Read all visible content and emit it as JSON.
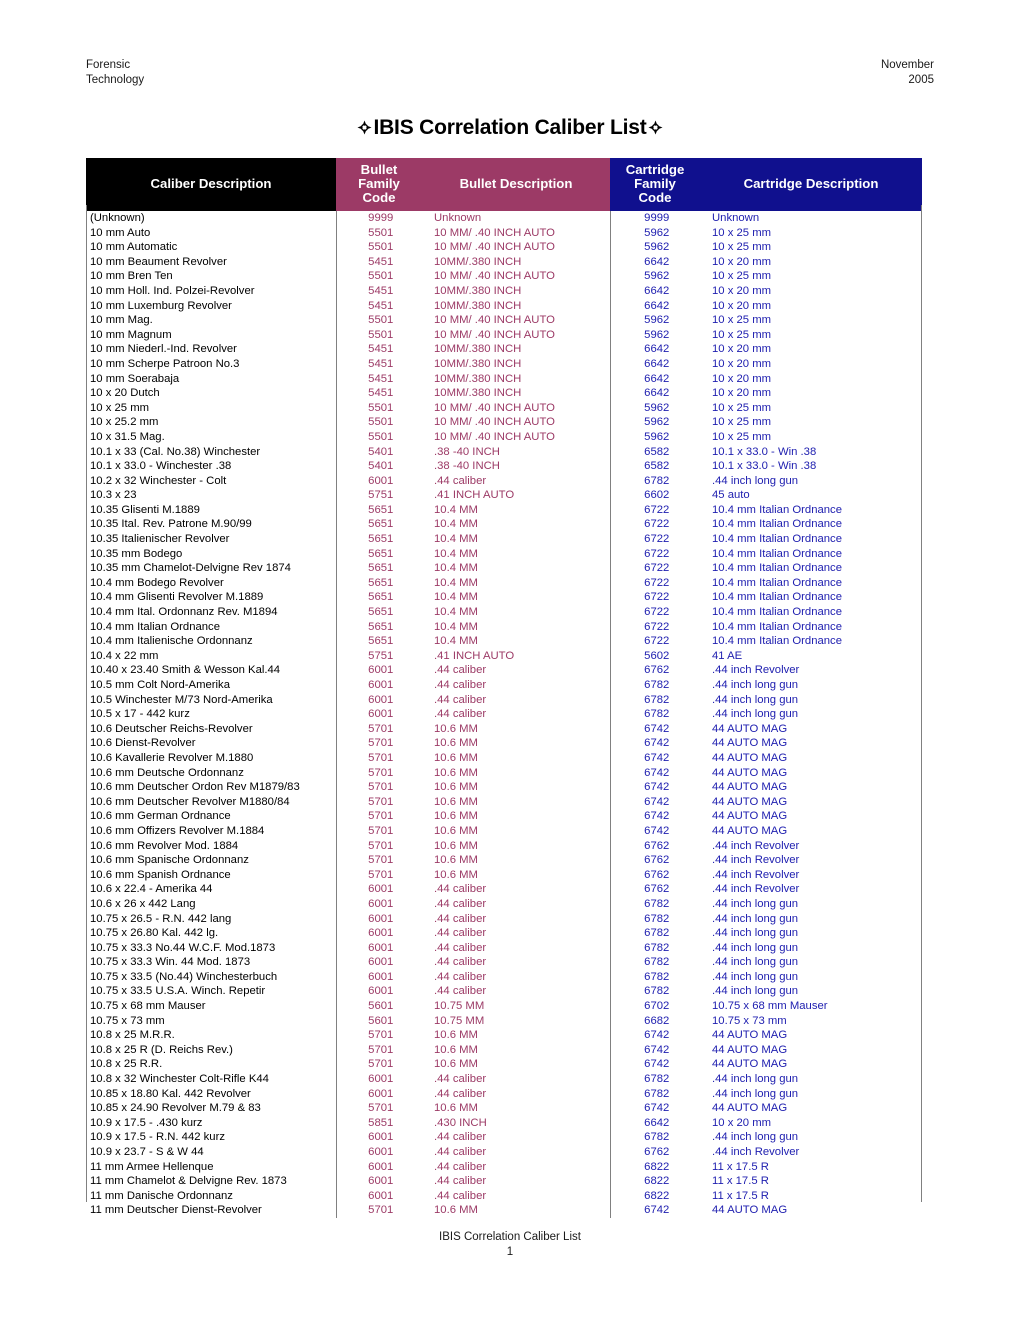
{
  "running_head": {
    "left_line1": "Forensic",
    "left_line2": "Technology",
    "right_line1": "November",
    "right_line2": "2005"
  },
  "title": {
    "text": "IBIS Correlation Caliber List",
    "left_icon": "crosshair-icon",
    "right_icon": "crosshair-icon"
  },
  "colors": {
    "caliber_header_bg": "#000000",
    "bullet_header_bg": "#9C3A66",
    "cartridge_header_bg": "#10108E",
    "bullet_text": "#9C3A66",
    "cartridge_text": "#2020B0",
    "rule": "#808080"
  },
  "table": {
    "columns": [
      "Caliber Description",
      "Bullet Family Code",
      "Bullet Description",
      "Cartridge Family Code",
      "Cartridge Description"
    ],
    "headers": {
      "caliber_description": "Caliber Description",
      "bullet_family_code_l1": "Bullet Family",
      "bullet_family_code_l2": "Code",
      "bullet_description": "Bullet Description",
      "cartridge_family_code_l1": "Cartridge Family",
      "cartridge_family_code_l2": "Code",
      "cartridge_description": "Cartridge Description"
    },
    "rows": [
      [
        "(Unknown)",
        "9999",
        "Unknown",
        "9999",
        "Unknown"
      ],
      [
        "10 mm Auto",
        "5501",
        "10 MM/ .40 INCH AUTO",
        "5962",
        "10 x 25 mm"
      ],
      [
        "10 mm Automatic",
        "5501",
        "10 MM/ .40 INCH AUTO",
        "5962",
        "10 x 25 mm"
      ],
      [
        "10 mm Beaument Revolver",
        "5451",
        "10MM/.380 INCH",
        "6642",
        "10 x 20 mm"
      ],
      [
        "10 mm Bren Ten",
        "5501",
        "10 MM/ .40 INCH AUTO",
        "5962",
        "10 x 25 mm"
      ],
      [
        "10 mm Holl. Ind. Polzei-Revolver",
        "5451",
        "10MM/.380 INCH",
        "6642",
        "10 x 20 mm"
      ],
      [
        "10 mm Luxemburg Revolver",
        "5451",
        "10MM/.380 INCH",
        "6642",
        "10 x 20 mm"
      ],
      [
        "10 mm Mag.",
        "5501",
        "10 MM/ .40 INCH AUTO",
        "5962",
        "10 x 25 mm"
      ],
      [
        "10 mm Magnum",
        "5501",
        "10 MM/ .40 INCH AUTO",
        "5962",
        "10 x 25 mm"
      ],
      [
        "10 mm Niederl.-Ind. Revolver",
        "5451",
        "10MM/.380 INCH",
        "6642",
        "10 x 20 mm"
      ],
      [
        "10 mm Scherpe Patroon No.3",
        "5451",
        "10MM/.380 INCH",
        "6642",
        "10 x 20 mm"
      ],
      [
        "10 mm Soerabaja",
        "5451",
        "10MM/.380 INCH",
        "6642",
        "10 x 20 mm"
      ],
      [
        "10 x 20 Dutch",
        "5451",
        "10MM/.380 INCH",
        "6642",
        "10 x 20 mm"
      ],
      [
        "10 x 25 mm",
        "5501",
        "10 MM/ .40 INCH AUTO",
        "5962",
        "10 x 25 mm"
      ],
      [
        "10 x 25.2 mm",
        "5501",
        "10 MM/ .40 INCH AUTO",
        "5962",
        "10 x 25 mm"
      ],
      [
        "10 x 31.5 Mag.",
        "5501",
        "10 MM/ .40 INCH AUTO",
        "5962",
        "10 x 25 mm"
      ],
      [
        "10.1 x 33 (Cal. No.38) Winchester",
        "5401",
        ".38 -40 INCH",
        "6582",
        "10.1 x 33.0 - Win .38"
      ],
      [
        "10.1 x 33.0 - Winchester .38",
        "5401",
        ".38 -40 INCH",
        "6582",
        "10.1 x 33.0 - Win .38"
      ],
      [
        "10.2 x 32 Winchester - Colt",
        "6001",
        ".44 caliber",
        "6782",
        ".44 inch long gun"
      ],
      [
        "10.3 x 23",
        "5751",
        ".41 INCH AUTO",
        "6602",
        "45 auto"
      ],
      [
        "10.35 Glisenti M.1889",
        "5651",
        "10.4 MM",
        "6722",
        "10.4 mm Italian Ordnance"
      ],
      [
        "10.35 Ital. Rev. Patrone M.90/99",
        "5651",
        "10.4 MM",
        "6722",
        "10.4 mm Italian Ordnance"
      ],
      [
        "10.35 Italienischer Revolver",
        "5651",
        "10.4 MM",
        "6722",
        "10.4 mm Italian Ordnance"
      ],
      [
        "10.35 mm Bodego",
        "5651",
        "10.4 MM",
        "6722",
        "10.4 mm Italian Ordnance"
      ],
      [
        "10.35 mm Chamelot-Delvigne Rev 1874",
        "5651",
        "10.4 MM",
        "6722",
        "10.4 mm Italian Ordnance"
      ],
      [
        "10.4 mm Bodego Revolver",
        "5651",
        "10.4 MM",
        "6722",
        "10.4 mm Italian Ordnance"
      ],
      [
        "10.4 mm Glisenti Revolver M.1889",
        "5651",
        "10.4 MM",
        "6722",
        "10.4 mm Italian Ordnance"
      ],
      [
        "10.4 mm Ital. Ordonnanz Rev. M1894",
        "5651",
        "10.4 MM",
        "6722",
        "10.4 mm Italian Ordnance"
      ],
      [
        "10.4 mm Italian Ordnance",
        "5651",
        "10.4 MM",
        "6722",
        "10.4 mm Italian Ordnance"
      ],
      [
        "10.4 mm Italienische Ordonnanz",
        "5651",
        "10.4 MM",
        "6722",
        "10.4 mm Italian Ordnance"
      ],
      [
        "10.4 x 22 mm",
        "5751",
        ".41 INCH AUTO",
        "5602",
        "41 AE"
      ],
      [
        "10.40 x 23.40 Smith & Wesson Kal.44",
        "6001",
        ".44 caliber",
        "6762",
        ".44 inch Revolver"
      ],
      [
        "10.5 mm Colt Nord-Amerika",
        "6001",
        ".44 caliber",
        "6782",
        ".44 inch long gun"
      ],
      [
        "10.5 Winchester M/73 Nord-Amerika",
        "6001",
        ".44 caliber",
        "6782",
        ".44 inch long gun"
      ],
      [
        "10.5 x 17 - 442 kurz",
        "6001",
        ".44 caliber",
        "6782",
        ".44 inch long gun"
      ],
      [
        "10.6 Deutscher Reichs-Revolver",
        "5701",
        "10.6 MM",
        "6742",
        "44 AUTO MAG"
      ],
      [
        "10.6 Dienst-Revolver",
        "5701",
        "10.6 MM",
        "6742",
        "44 AUTO MAG"
      ],
      [
        "10.6 Kavallerie Revolver M.1880",
        "5701",
        "10.6 MM",
        "6742",
        "44 AUTO MAG"
      ],
      [
        "10.6 mm Deutsche Ordonnanz",
        "5701",
        "10.6 MM",
        "6742",
        "44 AUTO MAG"
      ],
      [
        "10.6 mm Deutscher Ordon Rev M1879/83",
        "5701",
        "10.6 MM",
        "6742",
        "44 AUTO MAG"
      ],
      [
        "10.6 mm Deutscher Revolver M1880/84",
        "5701",
        "10.6 MM",
        "6742",
        "44 AUTO MAG"
      ],
      [
        "10.6 mm German Ordnance",
        "5701",
        "10.6 MM",
        "6742",
        "44 AUTO MAG"
      ],
      [
        "10.6 mm Offizers Revolver M.1884",
        "5701",
        "10.6 MM",
        "6742",
        "44 AUTO MAG"
      ],
      [
        "10.6 mm Revolver Mod. 1884",
        "5701",
        "10.6 MM",
        "6762",
        ".44 inch Revolver"
      ],
      [
        "10.6 mm Spanische Ordonnanz",
        "5701",
        "10.6 MM",
        "6762",
        ".44 inch Revolver"
      ],
      [
        "10.6 mm Spanish Ordnance",
        "5701",
        "10.6 MM",
        "6762",
        ".44 inch Revolver"
      ],
      [
        "10.6 x 22.4 - Amerika 44",
        "6001",
        ".44 caliber",
        "6762",
        ".44 inch Revolver"
      ],
      [
        "10.6 x 26 x 442 Lang",
        "6001",
        ".44 caliber",
        "6782",
        ".44 inch long gun"
      ],
      [
        "10.75 x 26.5 - R.N. 442 lang",
        "6001",
        ".44 caliber",
        "6782",
        ".44 inch long gun"
      ],
      [
        "10.75 x 26.80 Kal. 442 lg.",
        "6001",
        ".44 caliber",
        "6782",
        ".44 inch long gun"
      ],
      [
        "10.75 x 33.3 No.44 W.C.F. Mod.1873",
        "6001",
        ".44 caliber",
        "6782",
        ".44 inch long gun"
      ],
      [
        "10.75 x 33.3 Win. 44 Mod. 1873",
        "6001",
        ".44 caliber",
        "6782",
        ".44 inch long gun"
      ],
      [
        "10.75 x 33.5 (No.44) Winchesterbuch",
        "6001",
        ".44 caliber",
        "6782",
        ".44 inch long gun"
      ],
      [
        "10.75 x 33.5 U.S.A. Winch. Repetir",
        "6001",
        ".44 caliber",
        "6782",
        ".44 inch long gun"
      ],
      [
        "10.75 x 68 mm Mauser",
        "5601",
        "10.75 MM",
        "6702",
        "10.75 x 68 mm Mauser"
      ],
      [
        "10.75 x 73 mm",
        "5601",
        "10.75 MM",
        "6682",
        "10.75 x 73 mm"
      ],
      [
        "10.8 x 25 M.R.R.",
        "5701",
        "10.6 MM",
        "6742",
        "44 AUTO MAG"
      ],
      [
        "10.8 x 25 R (D. Reichs Rev.)",
        "5701",
        "10.6 MM",
        "6742",
        "44 AUTO MAG"
      ],
      [
        "10.8 x 25 R.R.",
        "5701",
        "10.6 MM",
        "6742",
        "44 AUTO MAG"
      ],
      [
        "10.8 x 32 Winchester Colt-Rifle K44",
        "6001",
        ".44 caliber",
        "6782",
        ".44 inch long gun"
      ],
      [
        "10.85 x 18.80 Kal. 442 Revolver",
        "6001",
        ".44 caliber",
        "6782",
        ".44 inch long gun"
      ],
      [
        "10.85 x 24.90 Revolver M.79 & 83",
        "5701",
        "10.6 MM",
        "6742",
        "44 AUTO MAG"
      ],
      [
        "10.9 x 17.5 - .430 kurz",
        "5851",
        ".430 INCH",
        "6642",
        "10 x 20 mm"
      ],
      [
        "10.9 x 17.5 - R.N. 442 kurz",
        "6001",
        ".44 caliber",
        "6782",
        ".44 inch long gun"
      ],
      [
        "10.9 x 23.7 - S & W 44",
        "6001",
        ".44 caliber",
        "6762",
        ".44 inch Revolver"
      ],
      [
        "11 mm Armee Hellenque",
        "6001",
        ".44 caliber",
        "6822",
        "11 x 17.5 R"
      ],
      [
        "11 mm Chamelot & Delvigne Rev. 1873",
        "6001",
        ".44 caliber",
        "6822",
        "11 x 17.5 R"
      ],
      [
        "11 mm Danische Ordonnanz",
        "6001",
        ".44 caliber",
        "6822",
        "11 x 17.5 R"
      ],
      [
        "11 mm Deutscher Dienst-Revolver",
        "5701",
        "10.6 MM",
        "6742",
        "44 AUTO MAG"
      ]
    ]
  },
  "footer": {
    "line1": "IBIS Correlation Caliber List",
    "line2": "1"
  }
}
